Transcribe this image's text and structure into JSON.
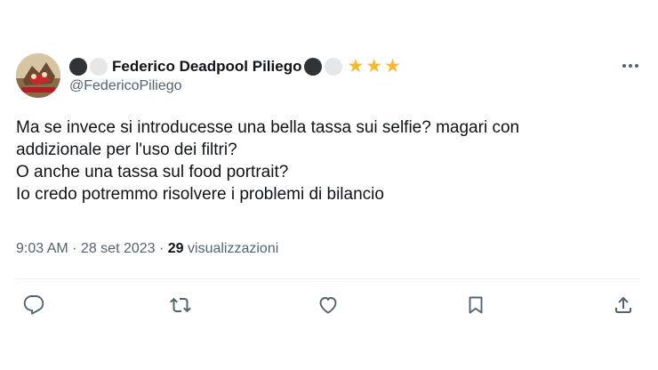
{
  "author": {
    "display_name": "Federico Deadpool Piliego",
    "handle": "@FedericoPiliego",
    "name_emojis_before": [
      "black-circle",
      "white-circle"
    ],
    "name_emojis_after": [
      "black-circle",
      "white-circle",
      "star",
      "star",
      "star"
    ],
    "avatar_icon": "avatar-image"
  },
  "tweet": {
    "lines": [
      "Ma se invece si introducesse una bella tassa sui selfie? magari con",
      "addizionale per l'uso dei filtri?",
      "O anche una tassa sul food portrait?",
      "Io credo potremmo risolvere i problemi di bilancio"
    ]
  },
  "meta": {
    "time": "9:03 AM",
    "separator": " · ",
    "date": "28 set 2023",
    "separator2": " · ",
    "views_count": "29",
    "views_label": " visualizzazioni"
  },
  "actions": [
    {
      "name": "reply",
      "icon": "reply-icon"
    },
    {
      "name": "retweet",
      "icon": "retweet-icon"
    },
    {
      "name": "like",
      "icon": "heart-icon"
    },
    {
      "name": "bookmark",
      "icon": "bookmark-icon"
    },
    {
      "name": "share",
      "icon": "share-icon"
    }
  ],
  "more_icon": "more-options-icon",
  "colors": {
    "text": "#0f1419",
    "secondary": "#536471",
    "divider": "#eff3f4",
    "star": "#f5b82e"
  }
}
